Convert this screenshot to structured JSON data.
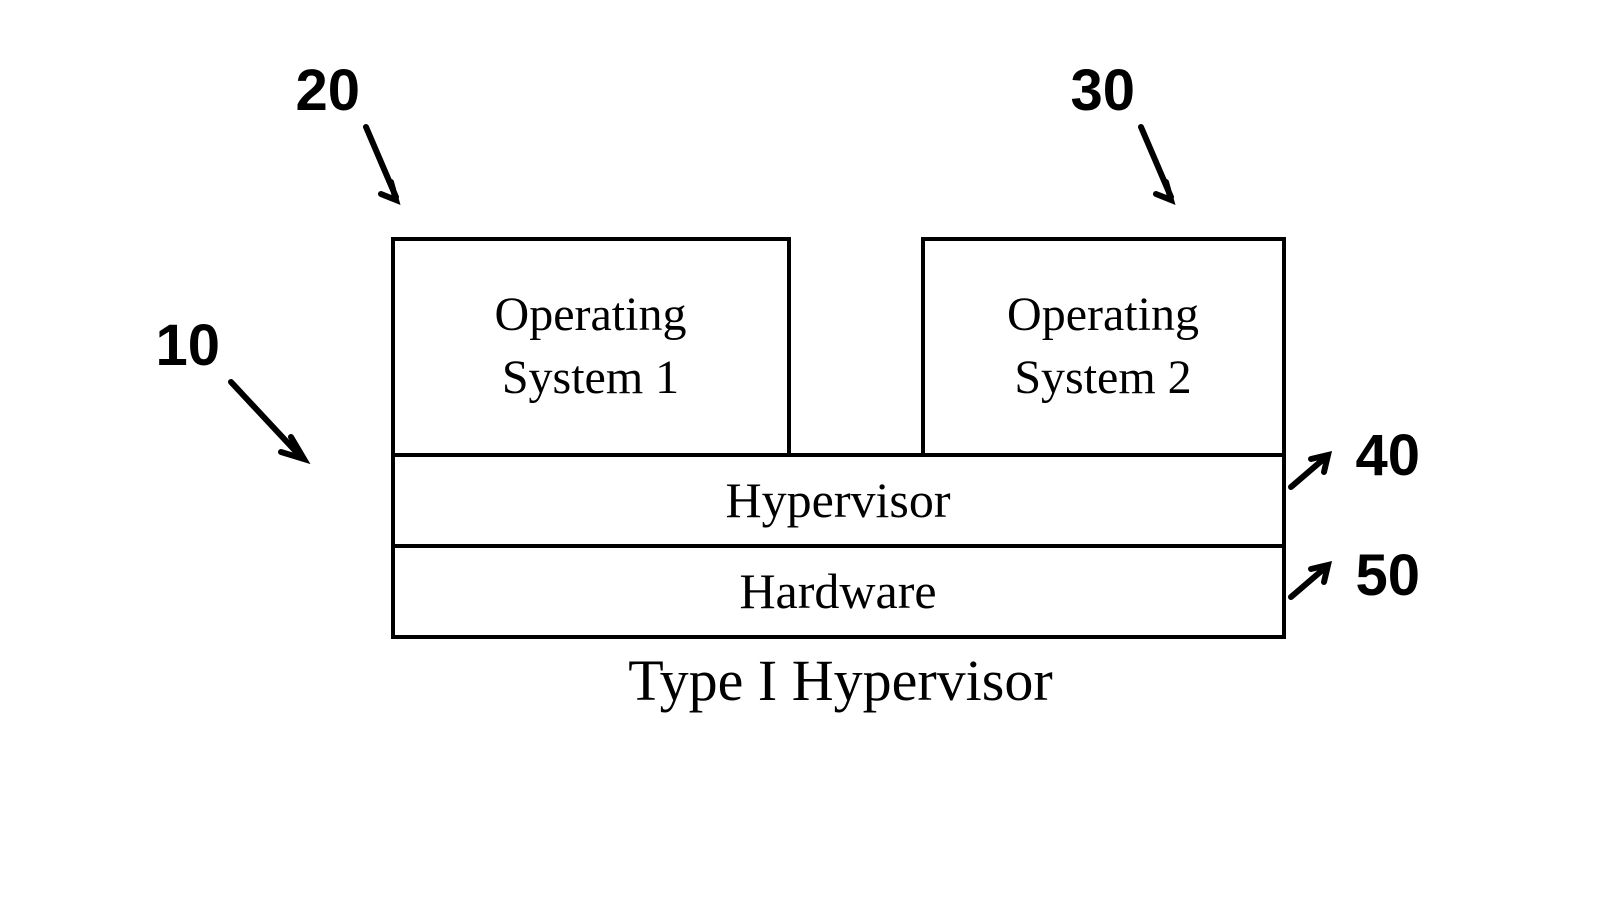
{
  "boxes": {
    "os1": "Operating\nSystem 1",
    "os2": "Operating\nSystem 2",
    "hypervisor": "Hypervisor",
    "hardware": "Hardware"
  },
  "caption": "Type I Hypervisor",
  "annotations": {
    "ref10": "10",
    "ref20": "20",
    "ref30": "30",
    "ref40": "40",
    "ref50": "50"
  }
}
